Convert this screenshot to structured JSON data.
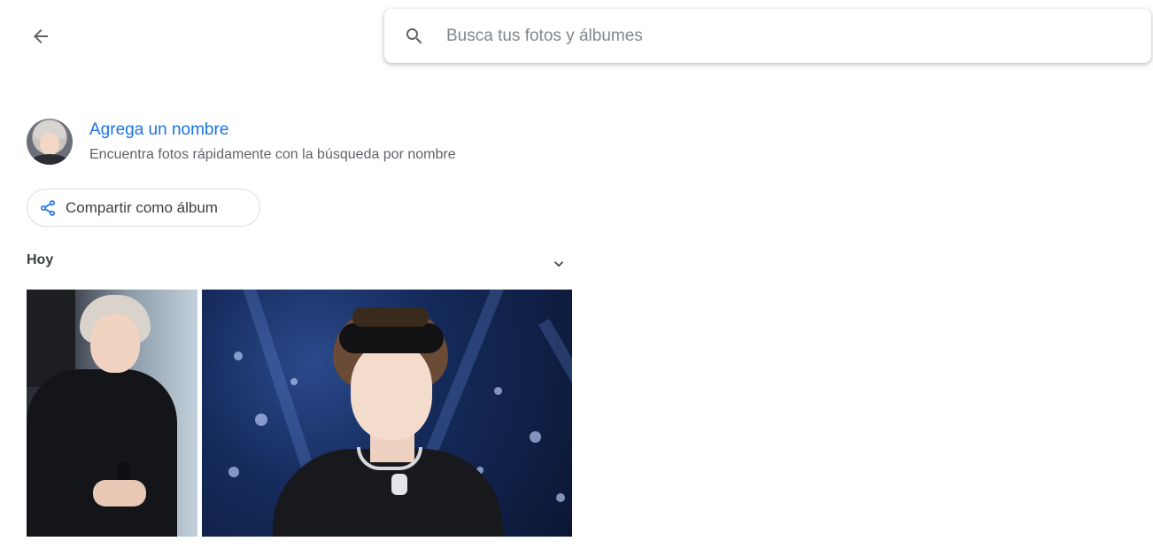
{
  "header": {
    "back_icon": "arrow-left-icon",
    "search": {
      "icon": "search-icon",
      "placeholder": "Busca tus fotos y álbumes",
      "value": ""
    }
  },
  "person": {
    "avatar_icon": "person-avatar",
    "add_name_label": "Agrega un nombre",
    "hint": "Encuentra fotos rápidamente con la búsqueda por nombre"
  },
  "share": {
    "icon": "share-icon",
    "label": "Compartir como álbum"
  },
  "section": {
    "label": "Hoy",
    "toggle_icon": "chevron-down-icon"
  },
  "colors": {
    "accent": "#1a73e8",
    "text_primary": "#3c4043",
    "text_secondary": "#5f6368",
    "border": "#dadce0"
  }
}
